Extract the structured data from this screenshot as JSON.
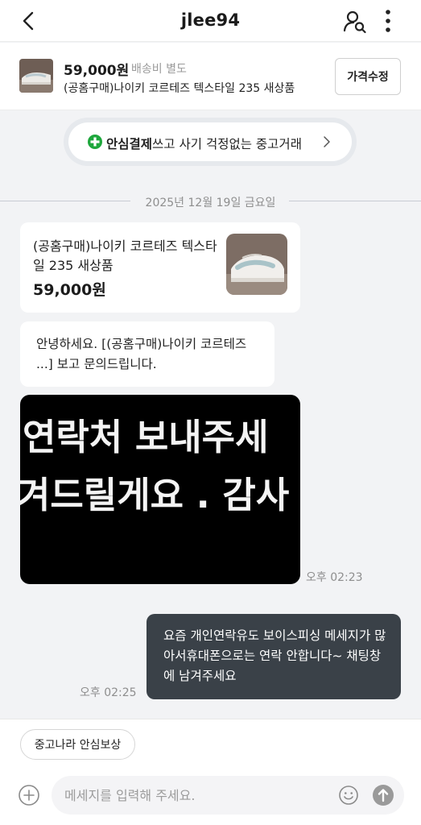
{
  "header": {
    "title": "jlee94",
    "icons": [
      "back-arrow-icon",
      "user-search-icon",
      "more-vertical-icon"
    ]
  },
  "product": {
    "price": "59,000원",
    "shipping": "배송비 별도",
    "name": "(공홈구매)나이키 코르테즈 텍스타일 235 새상품",
    "edit_label": "가격수정"
  },
  "safe_pay": {
    "bold": "안심결제",
    "rest": "쓰고 사기 걱정없는 중고거래",
    "icons": [
      "plus-circle-icon",
      "chevron-right-icon"
    ],
    "accent": "#1ea73c"
  },
  "chat": {
    "date": "2025년 12월 19일 금요일",
    "product_card": {
      "name": "(공홈구매)나이키 코르테즈 텍스타일 235 새상품",
      "price": "59,000원"
    },
    "inquiry": "안녕하세요. [(공홈구매)나이키 코르테즈 ...] 보고 문의드립니다.",
    "image_text": {
      "line1": "연락처 보내주세",
      "line2": "겨드릴게요 . 감사"
    },
    "image_time": "오후 02:23",
    "reply": "요즘 개인연락유도 보이스피싱 메세지가 많아서휴대폰으로는 연락 안합니다~ 채팅창에 남겨주세요",
    "reply_time": "오후 02:25"
  },
  "bottom": {
    "chip": "중고나라 안심보상",
    "input_placeholder": "메세지를 입력해 주세요.",
    "icons": [
      "plus-circle-icon",
      "emoji-icon",
      "send-icon"
    ]
  },
  "colors": {
    "outgoing_bubble": "#3a4148",
    "background": "#f2f3f5"
  }
}
